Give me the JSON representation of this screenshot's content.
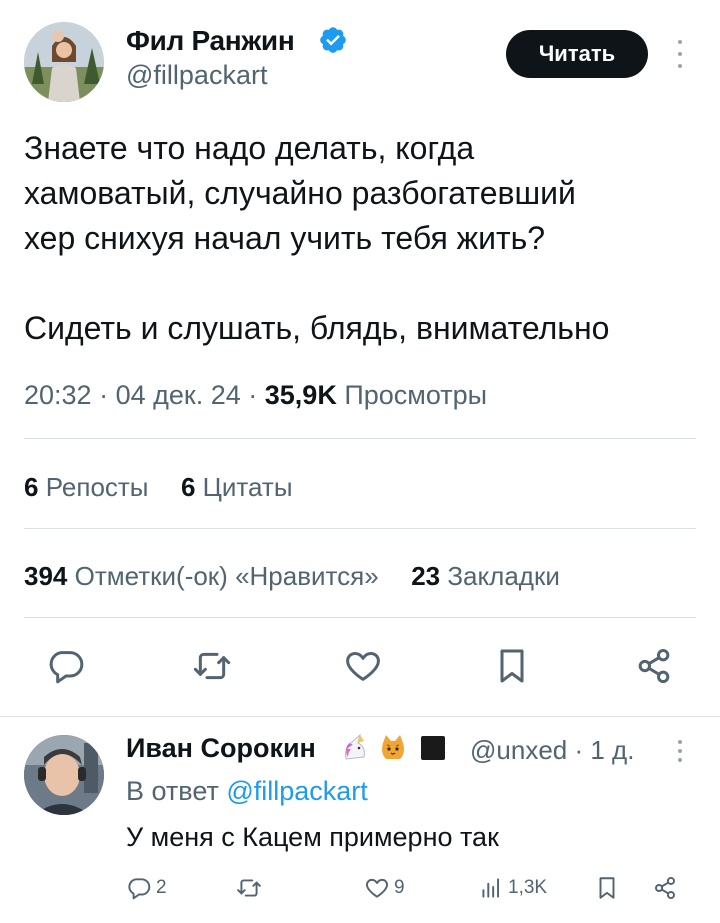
{
  "tweet": {
    "author_name": "Фил Ранжин",
    "author_handle": "@fillpackart",
    "follow_label": "Читать",
    "text": "Знаете что надо делать, когда\nхамоватый, случайно разбогатевший\nхер снихуя начал учить тебя жить?\n\nСидеть и слушать, блядь, внимательно",
    "time": "20:32",
    "date": "04 дек. 24",
    "views_count": "35,9K",
    "views_label": "Просмотры",
    "reposts_count": "6",
    "reposts_label": "Репосты",
    "quotes_count": "6",
    "quotes_label": "Цитаты",
    "likes_count": "394",
    "likes_label": "Отметки(-ок) «Нравится»",
    "bookmarks_count": "23",
    "bookmarks_label": "Закладки",
    "actions": [
      "reply-icon",
      "retweet-icon",
      "like-icon",
      "bookmark-icon",
      "share-icon"
    ]
  },
  "reply": {
    "author_name": "Иван Сорокин",
    "emojis": [
      "unicorn-icon",
      "cat-icon",
      "black-square-icon"
    ],
    "handle": "@unxed",
    "time_ago": "1 д.",
    "reply_to_prefix": "В ответ",
    "reply_to_handle": "@fillpackart",
    "text": "У меня с Кацем примерно так",
    "replies": "2",
    "retweets": "",
    "likes": "9",
    "views": "1,3K"
  },
  "colors": {
    "text": "#0f1419",
    "secondary": "#536471",
    "accent": "#1d9bf0",
    "divider": "#dbe0e4",
    "button_bg": "#0f1419"
  }
}
